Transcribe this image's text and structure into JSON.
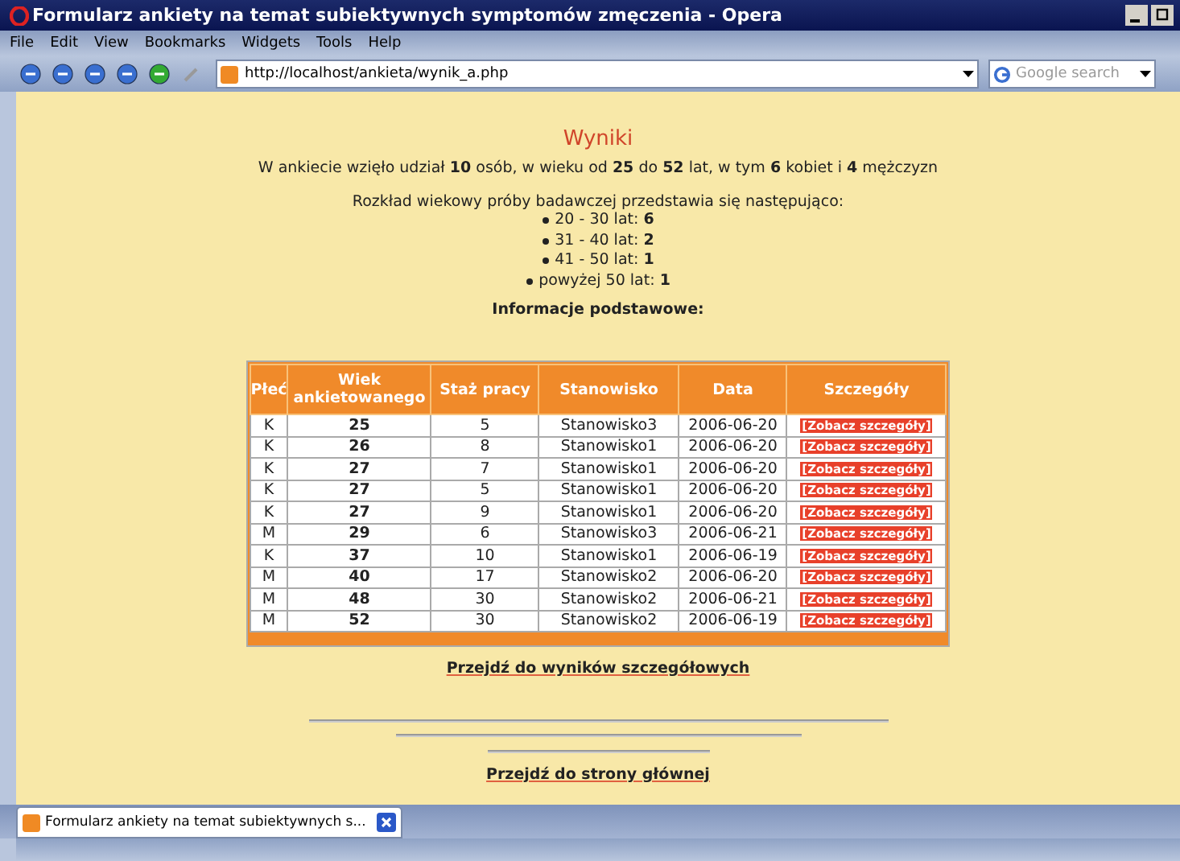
{
  "window": {
    "title": "Formularz ankiety na temat subiektywnych symptomów zmęczenia - Opera"
  },
  "menu": [
    "File",
    "Edit",
    "View",
    "Bookmarks",
    "Widgets",
    "Tools",
    "Help"
  ],
  "address": {
    "value": "http://localhost/ankieta/wynik_a.php"
  },
  "search": {
    "placeholder": "Google search"
  },
  "page": {
    "heading": "Wyniki",
    "summary": "W ankiecie wzięło udział **10** osób, w wieku od **25** do **52** lat, w tym **6** kobiet i **4** mężczyzn",
    "distribution_intro": "Rozkład wiekowy próby badawczej przedstawia się następująco:",
    "distribution": [
      "20 - 30 lat: **6**",
      "31 - 40 lat: **2**",
      "41 - 50 lat: **1**",
      "powyżej 50 lat: **1**"
    ],
    "section_title": "Informacje podstawowe:",
    "table": {
      "columns": [
        "Płeć",
        "Wiek ankietowanego",
        "Staż pracy",
        "Stanowisko",
        "Data",
        "Szczegóły"
      ],
      "rows": [
        {
          "sex": "K",
          "age": "25",
          "tenure": "5",
          "position": "Stanowisko3",
          "date": "2006-06-20",
          "details": "[Zobacz szczegóły]"
        },
        {
          "sex": "K",
          "age": "26",
          "tenure": "8",
          "position": "Stanowisko1",
          "date": "2006-06-20",
          "details": "[Zobacz szczegóły]"
        },
        {
          "sex": "K",
          "age": "27",
          "tenure": "7",
          "position": "Stanowisko1",
          "date": "2006-06-20",
          "details": "[Zobacz szczegóły]"
        },
        {
          "sex": "K",
          "age": "27",
          "tenure": "5",
          "position": "Stanowisko1",
          "date": "2006-06-20",
          "details": "[Zobacz szczegóły]"
        },
        {
          "sex": "K",
          "age": "27",
          "tenure": "9",
          "position": "Stanowisko1",
          "date": "2006-06-20",
          "details": "[Zobacz szczegóły]"
        },
        {
          "sex": "M",
          "age": "29",
          "tenure": "6",
          "position": "Stanowisko3",
          "date": "2006-06-21",
          "details": "[Zobacz szczegóły]"
        },
        {
          "sex": "K",
          "age": "37",
          "tenure": "10",
          "position": "Stanowisko1",
          "date": "2006-06-19",
          "details": "[Zobacz szczegóły]"
        },
        {
          "sex": "M",
          "age": "40",
          "tenure": "17",
          "position": "Stanowisko2",
          "date": "2006-06-20",
          "details": "[Zobacz szczegóły]"
        },
        {
          "sex": "M",
          "age": "48",
          "tenure": "30",
          "position": "Stanowisko2",
          "date": "2006-06-21",
          "details": "[Zobacz szczegóły]"
        },
        {
          "sex": "M",
          "age": "52",
          "tenure": "30",
          "position": "Stanowisko2",
          "date": "2006-06-19",
          "details": "[Zobacz szczegóły]"
        }
      ]
    },
    "detail_link": "Przejdź do wyników szczegółowych",
    "home_link": "Przejdź do strony głównej"
  },
  "tabs": [
    {
      "label": "Formularz ankiety na temat subiektywnych s...",
      "selected": true
    }
  ]
}
